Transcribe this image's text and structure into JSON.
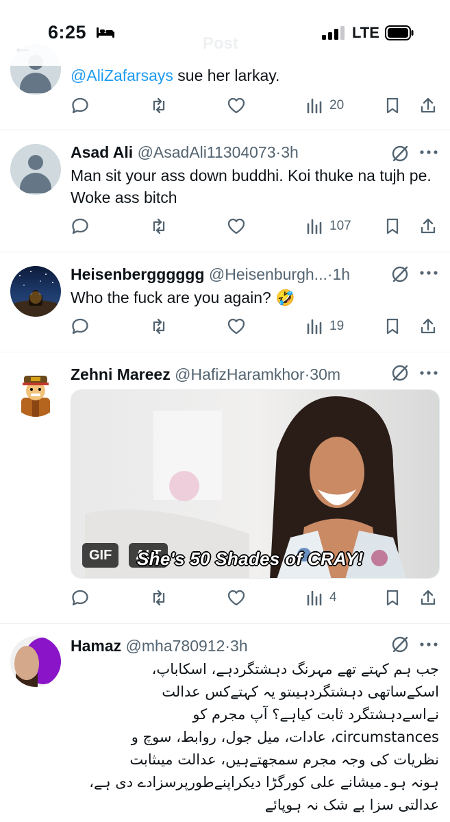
{
  "status_bar": {
    "time": "6:25",
    "network": "LTE",
    "icons": [
      "bed-icon",
      "signal-bars-icon",
      "battery-icon"
    ]
  },
  "ghost_header": {
    "title": "Post"
  },
  "tweets": [
    {
      "text_mention": "@AliZafarsays",
      "text_rest": " sue her larkay.",
      "views": "20"
    },
    {
      "name": "Asad Ali",
      "handle": "@AsadAli11304073",
      "time": "·3h",
      "text": "Man sit your ass down buddhi. Koi thuke na tujh pe. Woke ass bitch",
      "views": "107"
    },
    {
      "name": "Heisenbergggggg",
      "handle": "@Heisenburgh...",
      "time": "·1h",
      "text": "Who the fuck are you again? 🤣",
      "views": "19"
    },
    {
      "name": "Zehni Mareez",
      "handle": "@HafizHaramkhor",
      "time": "·30m",
      "media": {
        "gif_badge": "GIF",
        "alt_badge": "ALT",
        "caption": "She's 50 Shades of CRAY!"
      },
      "views": "4"
    },
    {
      "name": "Hamaz",
      "handle": "@mha780912",
      "time": "·3h",
      "text_lines": [
        "جب ہم کہتے تھے مہرنگ دہشتگردہے، اسکاباپ،",
        "اسکےساتھی دہشتگردہیںتو یہ کہتےکس عدالت",
        "نےاسےدہشتگرد ثابت کیاہے؟ آپ مجرم کو",
        "circumstances، عادات، میل جول، روابط، سوچ و",
        "نظریات کی وجہ مجرم سمجھتےہیں، عدالت میںثابت",
        "ہونہ ہو۔میشانے علی کورگڑا دیکراپنےطورپرسزادے دی ہے،",
        "عدالتی سزا بے شک نہ ہوپائے"
      ]
    }
  ],
  "colors": {
    "accent_link": "#1d9bf0",
    "text_primary": "#0f1419",
    "text_secondary": "#536471",
    "divider": "#eff3f4"
  }
}
